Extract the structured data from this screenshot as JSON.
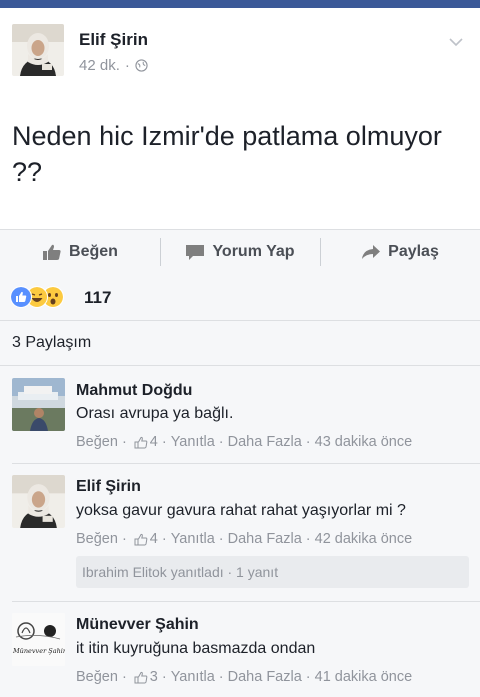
{
  "post": {
    "author": "Elif Şirin",
    "time": "42 dk.",
    "meta_separator": "·",
    "text": "Neden hic Izmir'de patlama olmuyor ??"
  },
  "actions": {
    "like": "Beğen",
    "comment": "Yorum Yap",
    "share": "Paylaş"
  },
  "reactions": {
    "icons": [
      "like-icon",
      "haha-icon",
      "wow-icon"
    ],
    "count": "117"
  },
  "shares": "3 Paylaşım",
  "comments": [
    {
      "author": "Mahmut Doğdu",
      "text": "Orası avrupa ya bağlı.",
      "like": "Beğen",
      "likes": "4",
      "reply": "Yanıtla",
      "more": "Daha Fazla",
      "time": "43 dakika önce"
    },
    {
      "author": "Elif Şirin",
      "text": "yoksa gavur gavura rahat rahat yaşıyorlar mi ?",
      "like": "Beğen",
      "likes": "4",
      "reply": "Yanıtla",
      "more": "Daha Fazla",
      "time": "42 dakika önce",
      "replies": "Ibrahim Elitok yanıtladı · 1 yanıt"
    },
    {
      "author": "Münevver Şahin",
      "text": "it itin kuyruğuna basmazda ondan",
      "like": "Beğen",
      "likes": "3",
      "reply": "Yanıtla",
      "more": "Daha Fazla",
      "time": "41 dakika önce",
      "avatar_text": "Münevver Şahin"
    }
  ],
  "colors": {
    "brand": "#3b5998",
    "like_blue": "#5890ff",
    "emoji_yellow": "#fcca40",
    "muted": "#90949c"
  }
}
